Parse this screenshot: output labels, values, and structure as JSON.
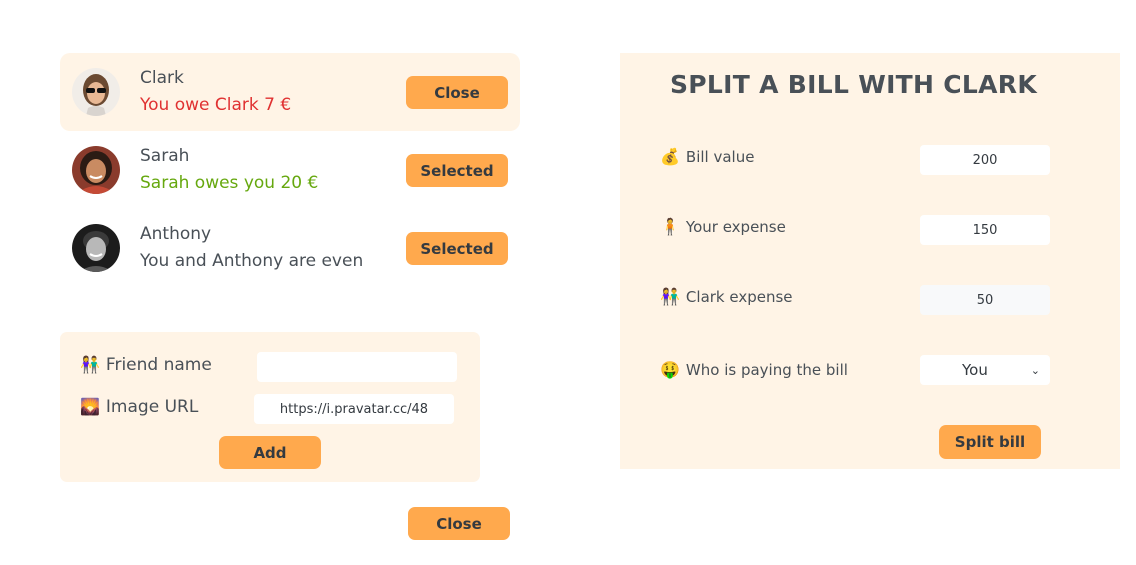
{
  "friends": [
    {
      "name": "Clark",
      "status": "You owe Clark 7 €",
      "button": "Close"
    },
    {
      "name": "Sarah",
      "status": "Sarah owes you 20 €",
      "button": "Selected"
    },
    {
      "name": "Anthony",
      "status": "You and Anthony are even",
      "button": "Selected"
    }
  ],
  "add_form": {
    "name_label": "Friend name",
    "name_value": "",
    "image_label": "Image URL",
    "image_value": "https://i.pravatar.cc/48",
    "add_button": "Add"
  },
  "close_button": "Close",
  "split": {
    "title": "SPLIT A BILL WITH CLARK",
    "bill_label": "Bill value",
    "bill_value": "200",
    "your_label": "Your expense",
    "your_value": "150",
    "friend_label": "Clark expense",
    "friend_value": "50",
    "payer_label": "Who is paying the bill",
    "payer_value": "You",
    "button": "Split bill"
  },
  "icons": {
    "friend_name": "people-holding-hands-icon",
    "image_url": "sunrise-image-icon",
    "bill_value": "money-bag-icon",
    "your_expense": "person-standing-icon",
    "friend_expense": "people-holding-hands-icon",
    "payer": "money-mouth-face-icon"
  },
  "colors": {
    "accent": "#ffa94d",
    "panel": "#fff4e6",
    "owe": "#e03131",
    "owed": "#66a80f"
  }
}
